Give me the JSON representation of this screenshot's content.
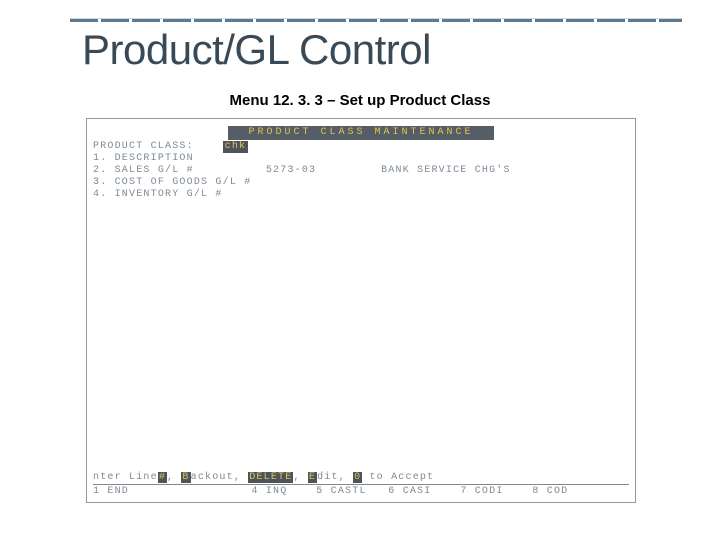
{
  "title": "Product/GL Control",
  "subtitle": "Menu 12. 3. 3 – Set up Product Class",
  "terminal": {
    "header": "PRODUCT CLASS MAINTENANCE",
    "productClassLabel": "PRODUCT CLASS:",
    "productClassValue": "chk",
    "rows": [
      {
        "num": "1.",
        "label": "DESCRIPTION",
        "value": "",
        "desc": ""
      },
      {
        "num": "2.",
        "label": "SALES G/L #",
        "value": "5273-03",
        "desc": "BANK SERVICE CHG'S"
      },
      {
        "num": "3.",
        "label": "COST OF GOODS G/L #",
        "value": "",
        "desc": ""
      },
      {
        "num": "4.",
        "label": "INVENTORY G/L #",
        "value": "",
        "desc": ""
      }
    ],
    "footer": {
      "prompt_parts": {
        "p0": "nter Line",
        "h0": "#",
        "p1": ", ",
        "h1": "B",
        "p2": "ackout, ",
        "h2": "DELETE",
        "p3": ", ",
        "h3": "E",
        "p4": "dit, ",
        "h4": "0",
        "p5": " to Accept"
      },
      "fkeys": [
        {
          "n": "1",
          "label": "END"
        },
        {
          "n": "4",
          "label": "INQ"
        },
        {
          "n": "5",
          "label": "CASTL"
        },
        {
          "n": "6",
          "label": "CASI"
        },
        {
          "n": "7",
          "label": "CODI"
        },
        {
          "n": "8",
          "label": "COD"
        }
      ]
    }
  }
}
